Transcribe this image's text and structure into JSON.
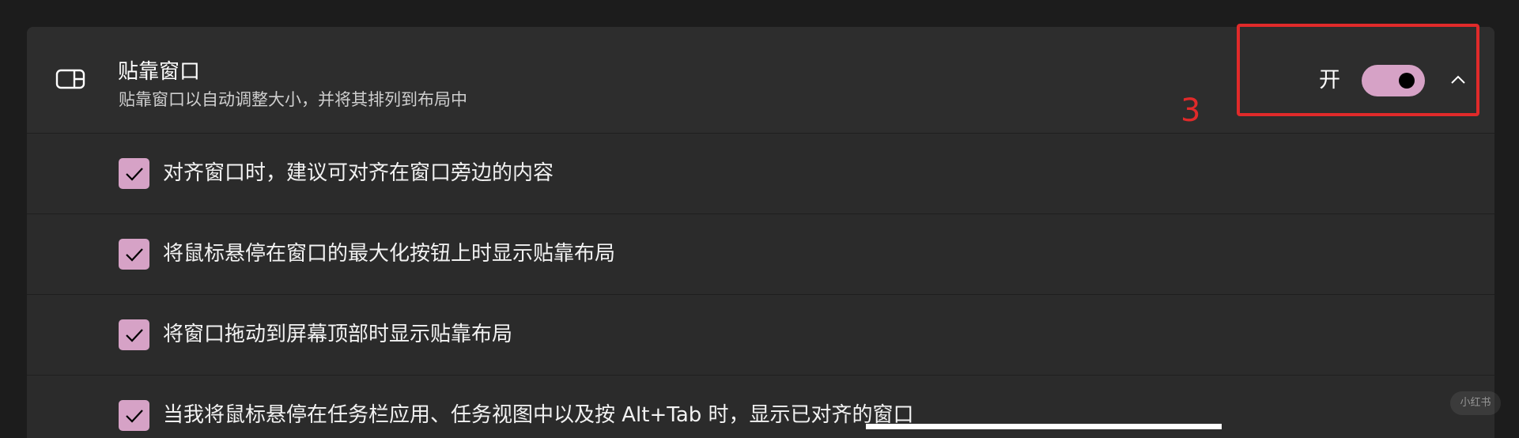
{
  "snap_windows": {
    "icon": "snap-window-icon",
    "title": "贴靠窗口",
    "subtitle": "贴靠窗口以自动调整大小，并将其排列到布局中",
    "toggle_state_label": "开",
    "toggle_on": true,
    "expand_icon": "chevron-up-icon"
  },
  "options": [
    {
      "label": "对齐窗口时，建议可对齐在窗口旁边的内容",
      "checked": true
    },
    {
      "label": "将鼠标悬停在窗口的最大化按钮上时显示贴靠布局",
      "checked": true
    },
    {
      "label": "将窗口拖动到屏幕顶部时显示贴靠布局",
      "checked": true
    },
    {
      "label": "当我将鼠标悬停在任务栏应用、任务视图中以及按 Alt+Tab 时，显示已对齐的窗口",
      "checked": true
    }
  ],
  "annotation": {
    "step_number": "3",
    "color": "#e02a2a"
  },
  "watermark": "小红书",
  "colors": {
    "accent": "#d6a2c6",
    "panel_bg": "#2b2b2b",
    "page_bg": "#1c1c1c"
  }
}
